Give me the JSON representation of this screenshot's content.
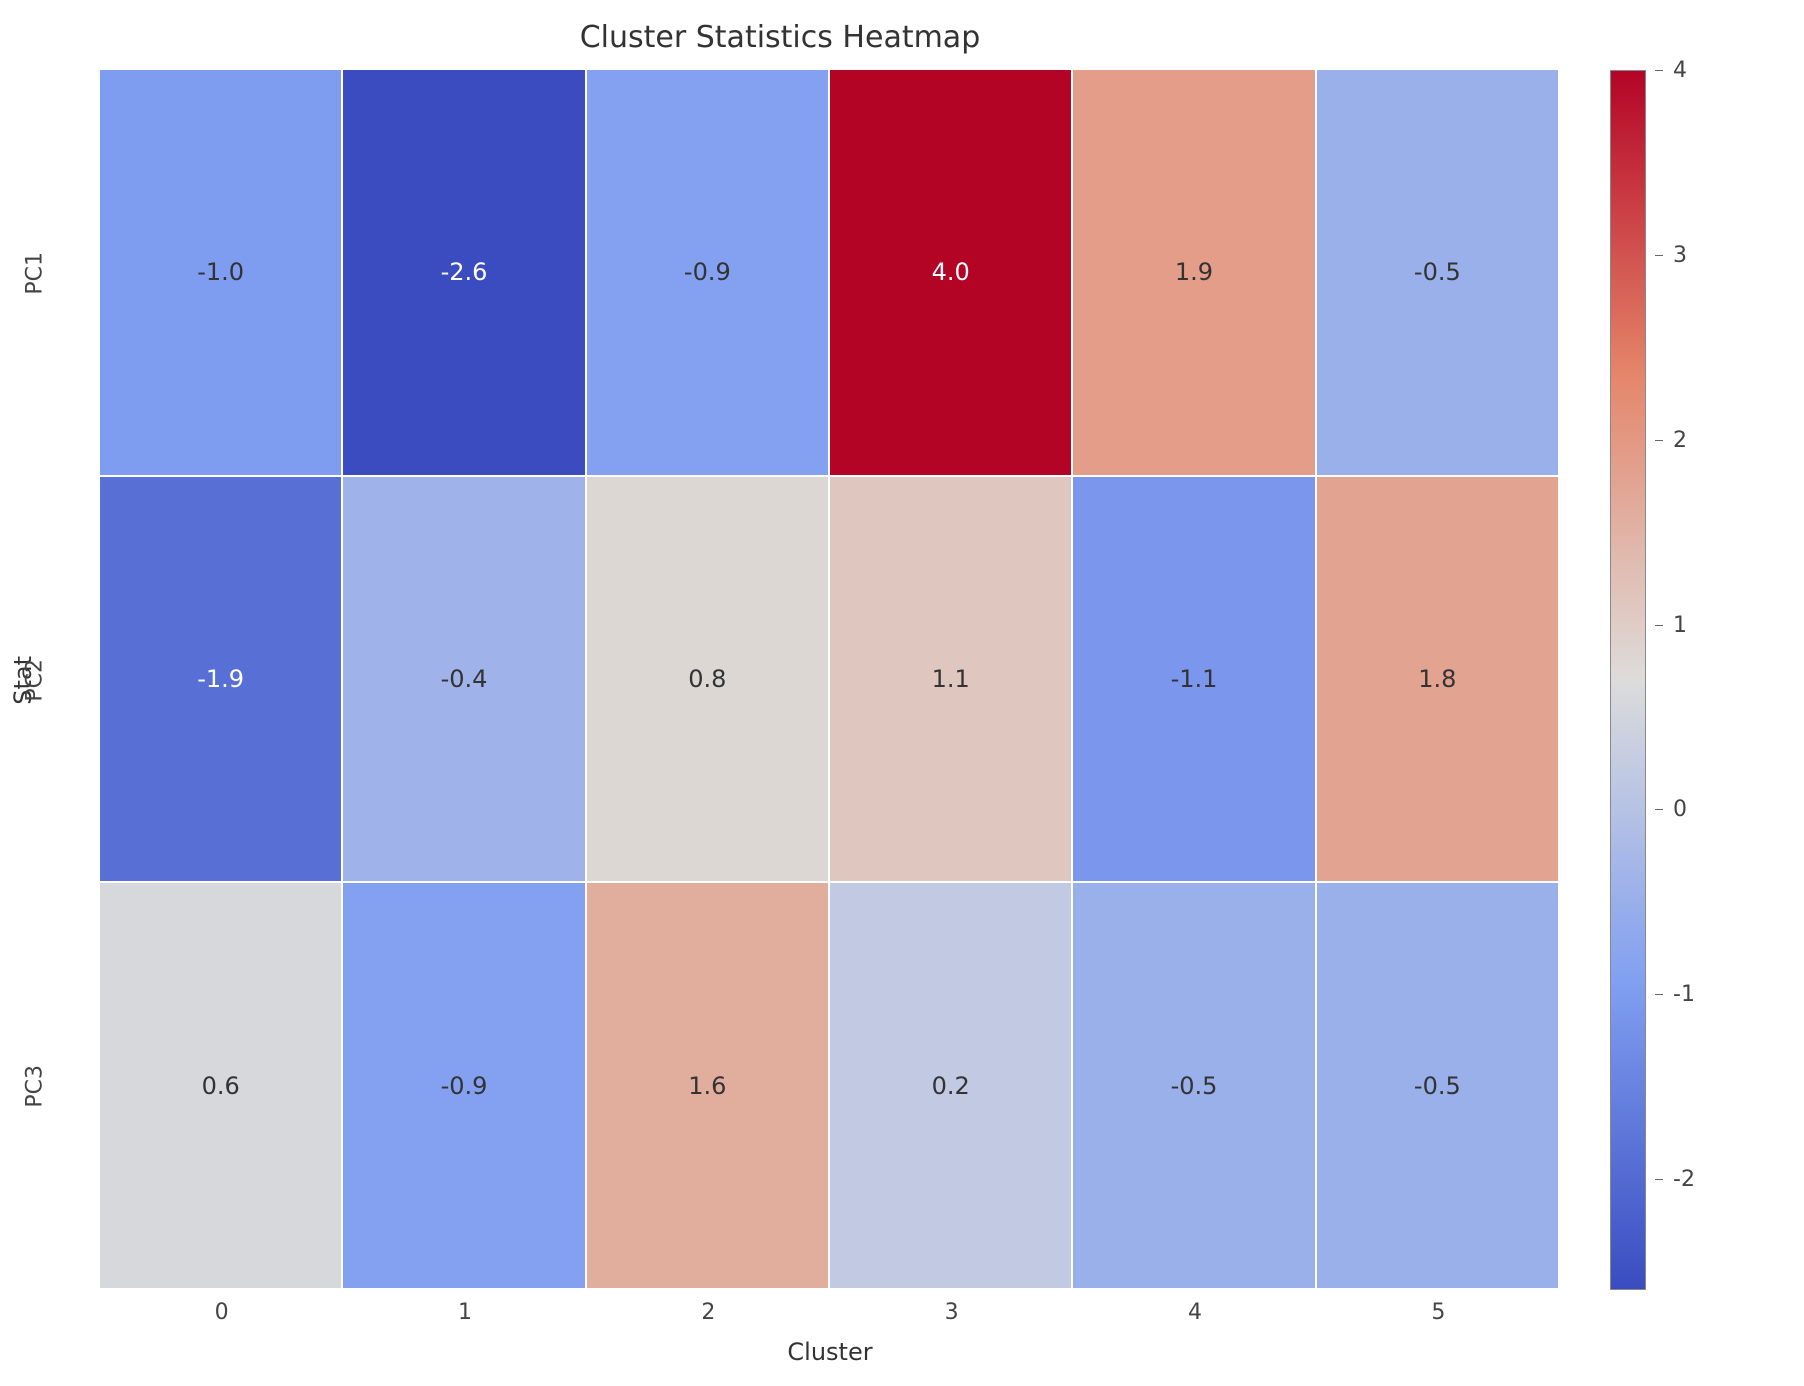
{
  "chart_data": {
    "type": "heatmap",
    "title": "Cluster Statistics Heatmap",
    "xlabel": "Cluster",
    "ylabel": "Stat",
    "x_categories": [
      "0",
      "1",
      "2",
      "3",
      "4",
      "5"
    ],
    "y_categories": [
      "PC1",
      "PC2",
      "PC3"
    ],
    "values": [
      [
        -1.0,
        -2.6,
        -0.9,
        4.0,
        1.9,
        -0.5
      ],
      [
        -1.9,
        -0.4,
        0.8,
        1.1,
        -1.1,
        1.8
      ],
      [
        0.6,
        -0.9,
        1.6,
        0.2,
        -0.5,
        -0.5
      ]
    ],
    "vmin": -2.6,
    "vmax": 4.0,
    "colormap": "coolwarm",
    "colorbar_ticks": [
      -2,
      -1,
      0,
      1,
      2,
      3,
      4
    ]
  }
}
